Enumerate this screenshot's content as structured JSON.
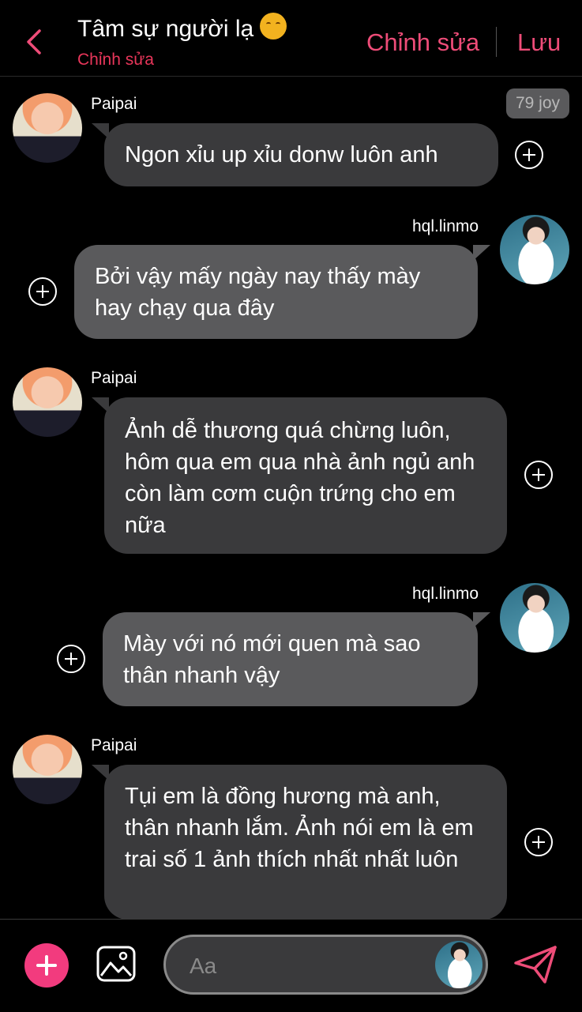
{
  "header": {
    "title": "Tâm sự người lạ",
    "subtitle": "Chỉnh sửa",
    "edit_label": "Chỉnh sửa",
    "save_label": "Lưu"
  },
  "badge": "79 joy",
  "messages": [
    {
      "sender": "Paipai",
      "text": "Ngon xỉu up xỉu donw luôn anh"
    },
    {
      "sender": "hql.linmo",
      "text": "Bởi vậy mấy ngày nay thấy mày hay chạy qua đây"
    },
    {
      "sender": "Paipai",
      "text": "Ảnh dễ thương quá chừng luôn, hôm qua em qua nhà ảnh ngủ anh còn làm cơm cuộn trứng cho em nữa"
    },
    {
      "sender": "hql.linmo",
      "text": "Mày với nó mới quen mà sao thân nhanh vậy"
    },
    {
      "sender": "Paipai",
      "text": "Tụi em là đồng hương mà anh, thân nhanh lắm. Ảnh nói em là em trai số 1 ảnh thích nhất nhất luôn"
    }
  ],
  "composer": {
    "placeholder": "Aa"
  },
  "colors": {
    "accent": "#ee4c78",
    "subtitle": "#e8365a",
    "add_button": "#f23b7e",
    "bubble_left": "#3a3a3c",
    "bubble_right": "#5a5a5c"
  }
}
